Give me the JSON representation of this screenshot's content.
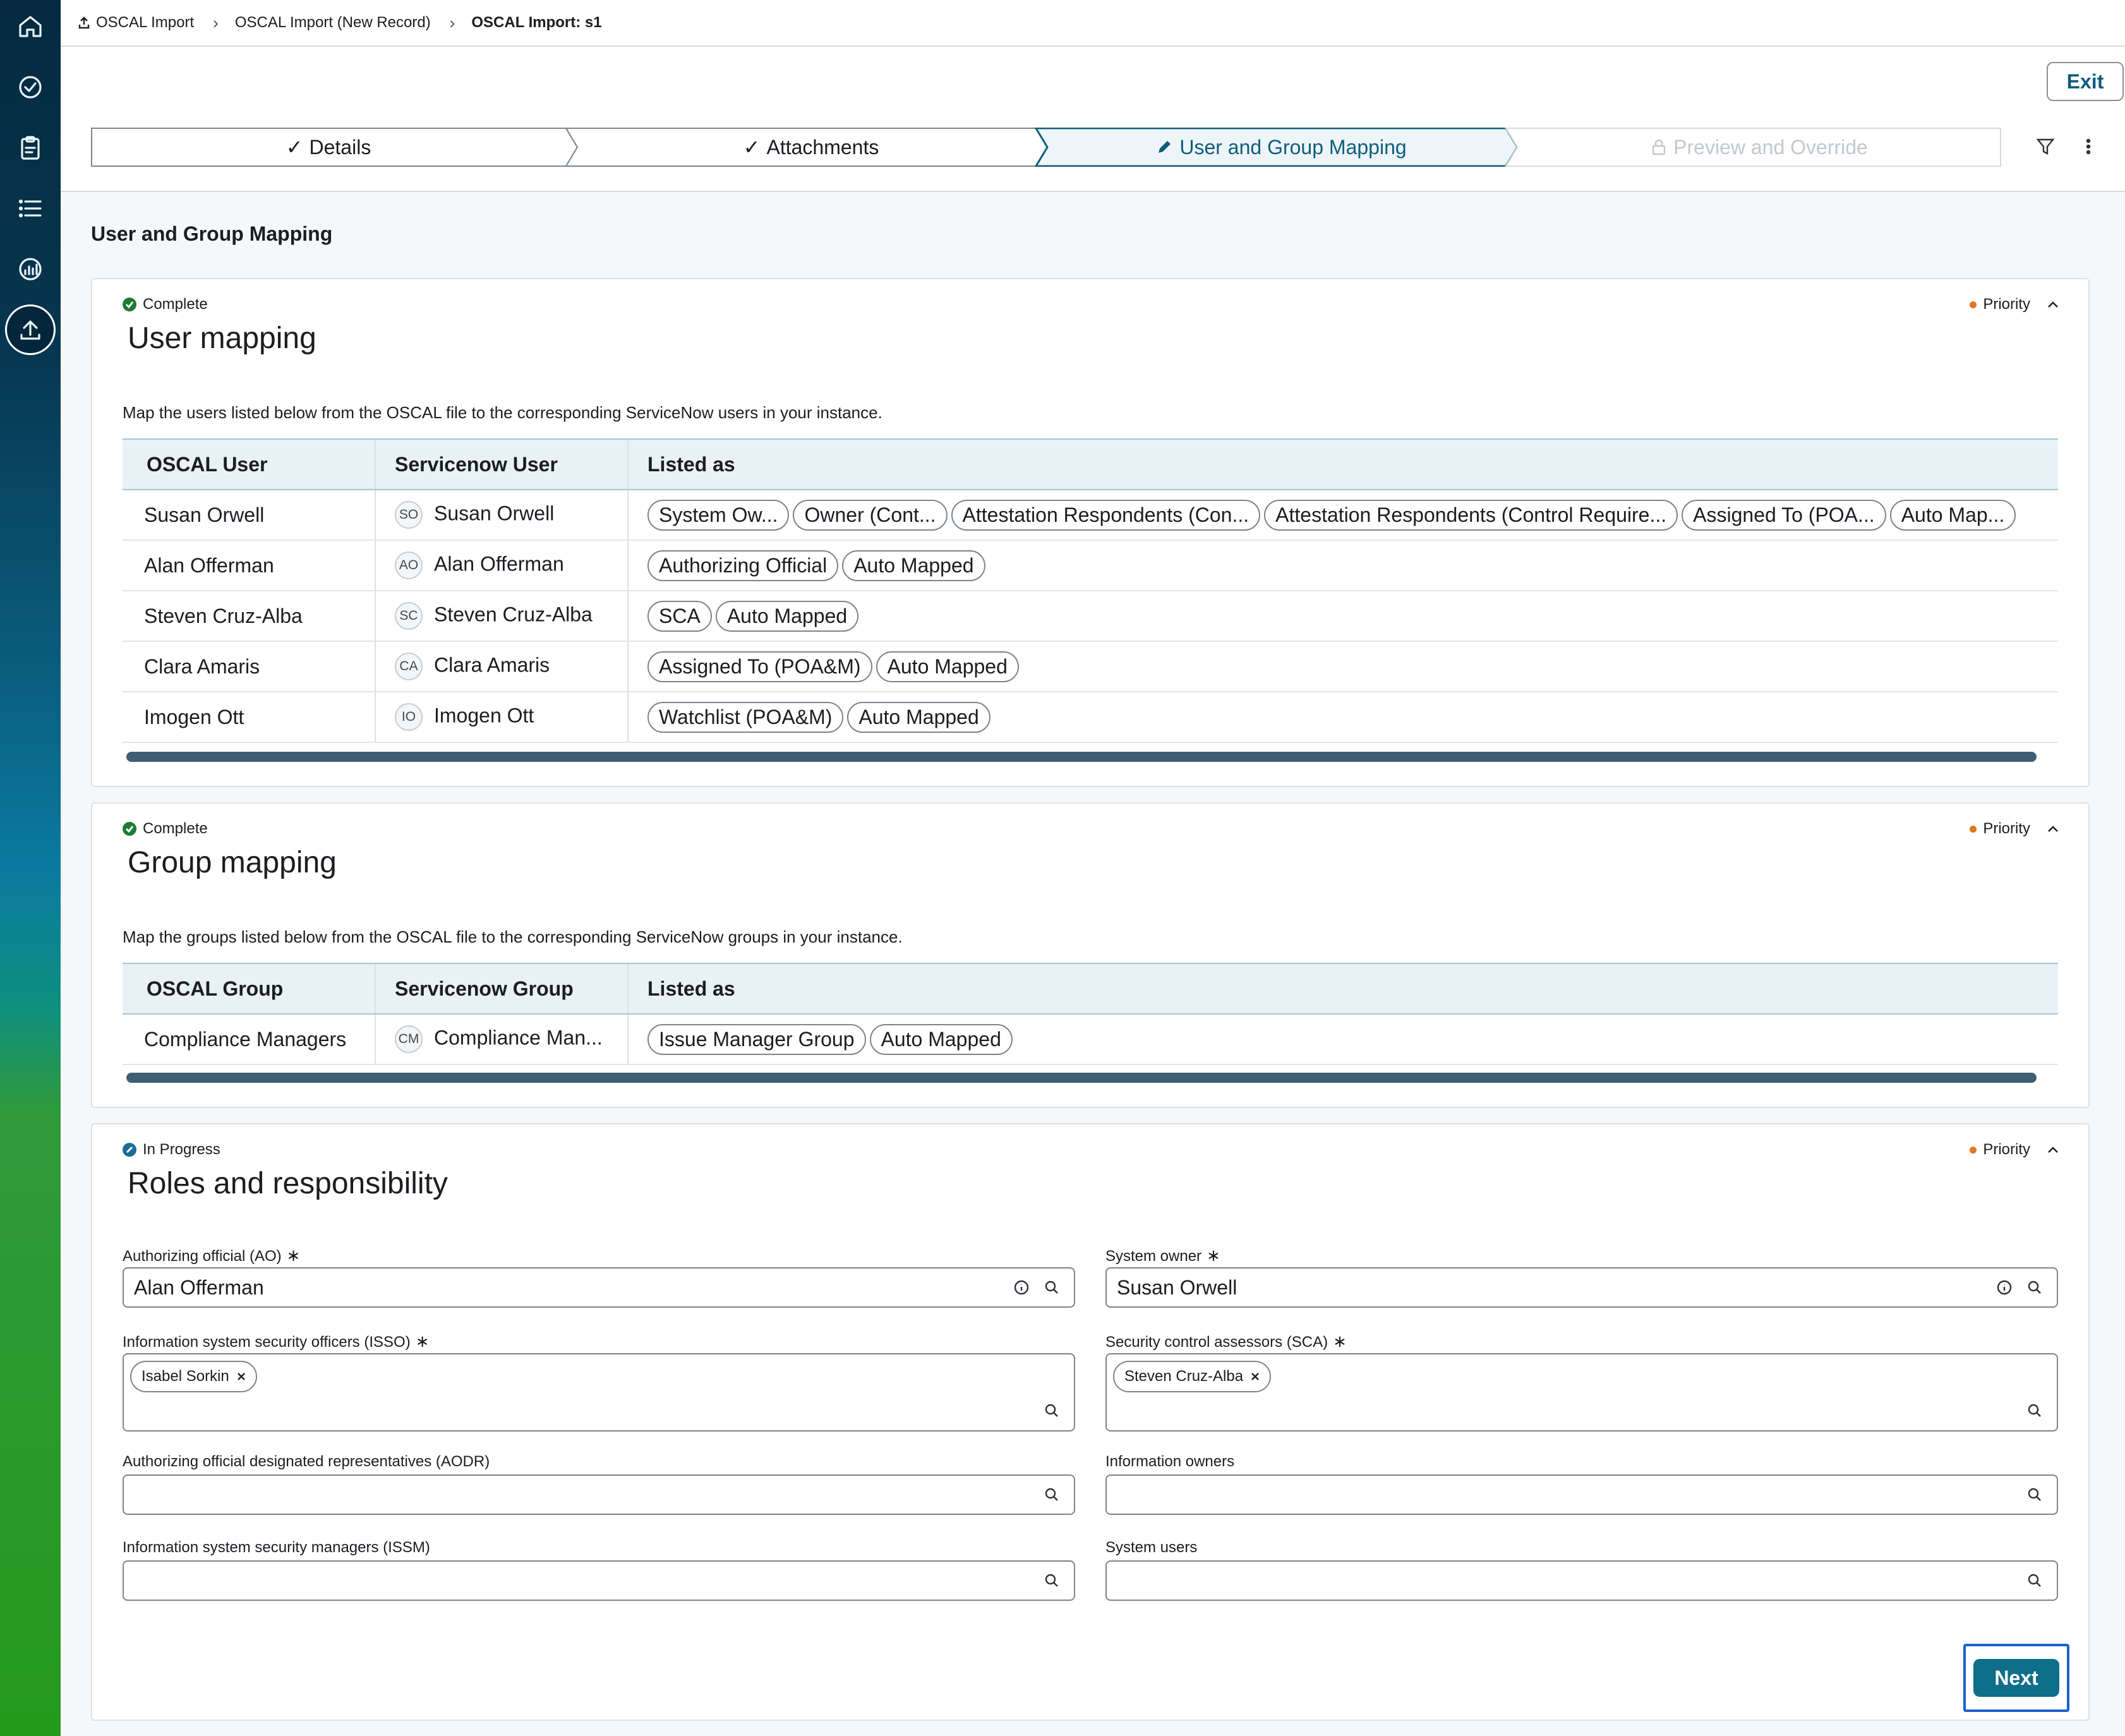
{
  "breadcrumb": {
    "items": [
      "OSCAL Import",
      "OSCAL Import (New Record)",
      "OSCAL Import: s1"
    ]
  },
  "header": {
    "exit_label": "Exit"
  },
  "stepper": {
    "steps": [
      {
        "label": "Details",
        "state": "done"
      },
      {
        "label": "Attachments",
        "state": "done"
      },
      {
        "label": "User and Group Mapping",
        "state": "current"
      },
      {
        "label": "Preview and Override",
        "state": "locked"
      }
    ]
  },
  "page": {
    "title": "User and Group Mapping"
  },
  "user_mapping": {
    "status": "Complete",
    "priority": "Priority",
    "title": "User mapping",
    "description": "Map the users listed below from the OSCAL file to the corresponding ServiceNow users in your instance.",
    "columns": [
      "OSCAL User",
      "Servicenow User",
      "Listed as"
    ],
    "rows": [
      {
        "oscal": "Susan Orwell",
        "initials": "SO",
        "servicenow": "Susan Orwell",
        "listed": [
          "System Ow...",
          "Owner (Cont...",
          "Attestation Respondents (Con...",
          "Attestation Respondents (Control Require...",
          "Assigned To (POA...",
          "Auto Map..."
        ]
      },
      {
        "oscal": "Alan Offerman",
        "initials": "AO",
        "servicenow": "Alan Offerman",
        "listed": [
          "Authorizing Official",
          "Auto Mapped"
        ]
      },
      {
        "oscal": "Steven Cruz-Alba",
        "initials": "SC",
        "servicenow": "Steven Cruz-Alba",
        "listed": [
          "SCA",
          "Auto Mapped"
        ]
      },
      {
        "oscal": "Clara Amaris",
        "initials": "CA",
        "servicenow": "Clara Amaris",
        "listed": [
          "Assigned To (POA&M)",
          "Auto Mapped"
        ]
      },
      {
        "oscal": "Imogen Ott",
        "initials": "IO",
        "servicenow": "Imogen Ott",
        "listed": [
          "Watchlist (POA&M)",
          "Auto Mapped"
        ]
      }
    ]
  },
  "group_mapping": {
    "status": "Complete",
    "priority": "Priority",
    "title": "Group mapping",
    "description": "Map the groups listed below from the OSCAL file to the corresponding ServiceNow groups in your instance.",
    "columns": [
      "OSCAL Group",
      "Servicenow Group",
      "Listed as"
    ],
    "rows": [
      {
        "oscal": "Compliance Managers",
        "initials": "CM",
        "servicenow": "Compliance Man...",
        "listed": [
          "Issue Manager Group",
          "Auto Mapped"
        ]
      }
    ]
  },
  "roles": {
    "status": "In Progress",
    "priority": "Priority",
    "title": "Roles and responsibility",
    "ao_label": "Authorizing official (AO)",
    "ao_value": "Alan Offerman",
    "owner_label": "System owner",
    "owner_value": "Susan Orwell",
    "isso_label": "Information system security officers (ISSO)",
    "isso_chip": "Isabel Sorkin",
    "sca_label": "Security control assessors (SCA)",
    "sca_chip": "Steven Cruz-Alba",
    "aodr_label": "Authorizing official designated representatives (AODR)",
    "info_owners_label": "Information owners",
    "issm_label": "Information system security managers (ISSM)",
    "system_users_label": "System users",
    "required_mark": "∗"
  },
  "footer": {
    "next_label": "Next"
  },
  "colors": {
    "accent": "#0f6e8a",
    "complete": "#1e7a34",
    "in_progress": "#1a6d96",
    "priority": "#e3761e",
    "focus": "#1e5fcf"
  },
  "icons": [
    "home-icon",
    "check-circle-icon",
    "clipboard-icon",
    "list-icon",
    "dashboard-icon",
    "upload-icon",
    "filter-icon",
    "more-vertical-icon",
    "search-icon",
    "info-icon",
    "lock-icon",
    "pencil-icon"
  ]
}
